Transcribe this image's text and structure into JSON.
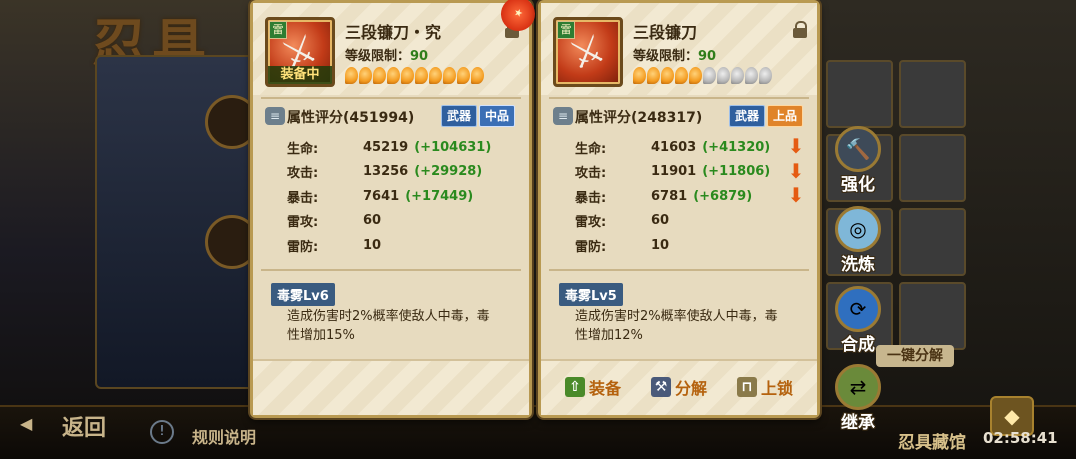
{
  "background": {
    "title_fragment": "忍具",
    "back_label": "返回",
    "rules_label": "规则说明",
    "vault_label": "忍具藏馆",
    "clock": "02:58:41",
    "one_click_label": "一键分解"
  },
  "card_current": {
    "name": "三段镰刀・究",
    "level_limit_label": "等级限制：",
    "level_limit": "90",
    "equipped_tag": "装备中",
    "magatama_total": 10,
    "magatama_filled": 10,
    "score_label": "属性评分(451994)",
    "tag_type": "武器",
    "tag_quality": "中品",
    "attributes": [
      {
        "label": "生命:",
        "value": "45219",
        "diff": "(+104631)"
      },
      {
        "label": "攻击:",
        "value": "13256",
        "diff": "(+29928)"
      },
      {
        "label": "暴击:",
        "value": "7641",
        "diff": "(+17449)"
      },
      {
        "label": "雷攻:",
        "value": "60",
        "diff": ""
      },
      {
        "label": "雷防:",
        "value": "10",
        "diff": ""
      }
    ],
    "skill_name": "毒雾Lv6",
    "skill_desc": "造成伤害时2%概率使敌人中毒，毒性增加15%"
  },
  "card_compare": {
    "name": "三段镰刀",
    "level_limit_label": "等级限制：",
    "level_limit": "90",
    "magatama_total": 10,
    "magatama_filled": 5,
    "score_label": "属性评分(248317)",
    "tag_type": "武器",
    "tag_quality": "上品",
    "attributes": [
      {
        "label": "生命:",
        "value": "41603",
        "diff": "(+41320)"
      },
      {
        "label": "攻击:",
        "value": "11901",
        "diff": "(+11806)"
      },
      {
        "label": "暴击:",
        "value": "6781",
        "diff": "(+6879)"
      },
      {
        "label": "雷攻:",
        "value": "60",
        "diff": ""
      },
      {
        "label": "雷防:",
        "value": "10",
        "diff": ""
      }
    ],
    "skill_name": "毒雾Lv5",
    "skill_desc": "造成伤害时2%概率使敌人中毒，毒性增加12%",
    "actions": {
      "equip": "装备",
      "decompose": "分解",
      "lock": "上锁"
    }
  },
  "side_actions": [
    {
      "label": "强化",
      "icon": "hammer-icon"
    },
    {
      "label": "洗炼",
      "icon": "swirl-icon"
    },
    {
      "label": "合成",
      "icon": "merge-icon"
    },
    {
      "label": "继承",
      "icon": "inherit-icon"
    }
  ],
  "colors": {
    "card_bg": "#e7dbbf",
    "frame_gold": "#b99a52",
    "positive_green": "#2a8a1e",
    "down_arrow": "#e55b12",
    "action_orange": "#b5620e",
    "weapon_tag": "#2f5f9e",
    "mid_quality": "#3b6fb5",
    "high_quality": "#e0842a"
  }
}
